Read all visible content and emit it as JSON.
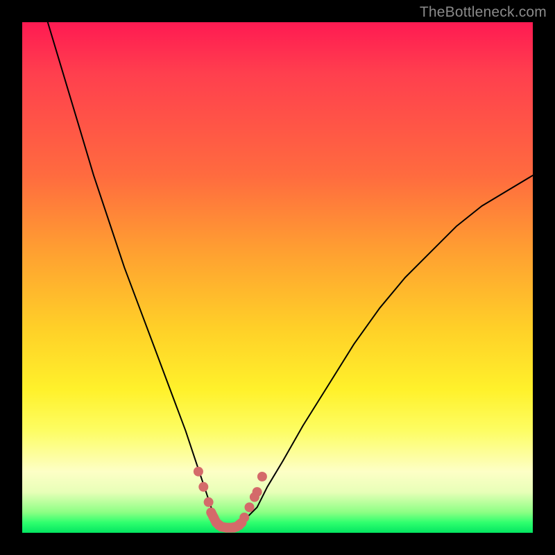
{
  "watermark": "TheBottleneck.com",
  "colors": {
    "background": "#000000",
    "gradient_top": "#ff1a52",
    "gradient_mid": "#ffd028",
    "gradient_bottom": "#03e561",
    "curve": "#000000",
    "markers": "#d46a6a"
  },
  "chart_data": {
    "type": "line",
    "title": "",
    "xlabel": "",
    "ylabel": "",
    "xlim": [
      0,
      100
    ],
    "ylim": [
      0,
      100
    ],
    "x": [
      5,
      8,
      11,
      14,
      17,
      20,
      23,
      26,
      29,
      32,
      34,
      36,
      37,
      38,
      39,
      40,
      41,
      42,
      43,
      44,
      46,
      48,
      51,
      55,
      60,
      65,
      70,
      75,
      80,
      85,
      90,
      95,
      100
    ],
    "y": [
      100,
      90,
      80,
      70,
      61,
      52,
      44,
      36,
      28,
      20,
      14,
      8,
      5,
      3,
      2,
      1,
      1,
      1,
      2,
      3,
      5,
      9,
      14,
      21,
      29,
      37,
      44,
      50,
      55,
      60,
      64,
      67,
      70
    ],
    "markers": {
      "x": [
        34.5,
        35.5,
        36.5,
        37.0,
        37.5,
        38.5,
        40.0,
        41.5,
        42.5,
        43.5,
        44.5,
        45.5,
        46.0,
        47.0
      ],
      "y": [
        12,
        9,
        6,
        4,
        3,
        1.5,
        1,
        1,
        1.5,
        3,
        5,
        7,
        8,
        11
      ]
    },
    "legend": null,
    "annotations": []
  }
}
